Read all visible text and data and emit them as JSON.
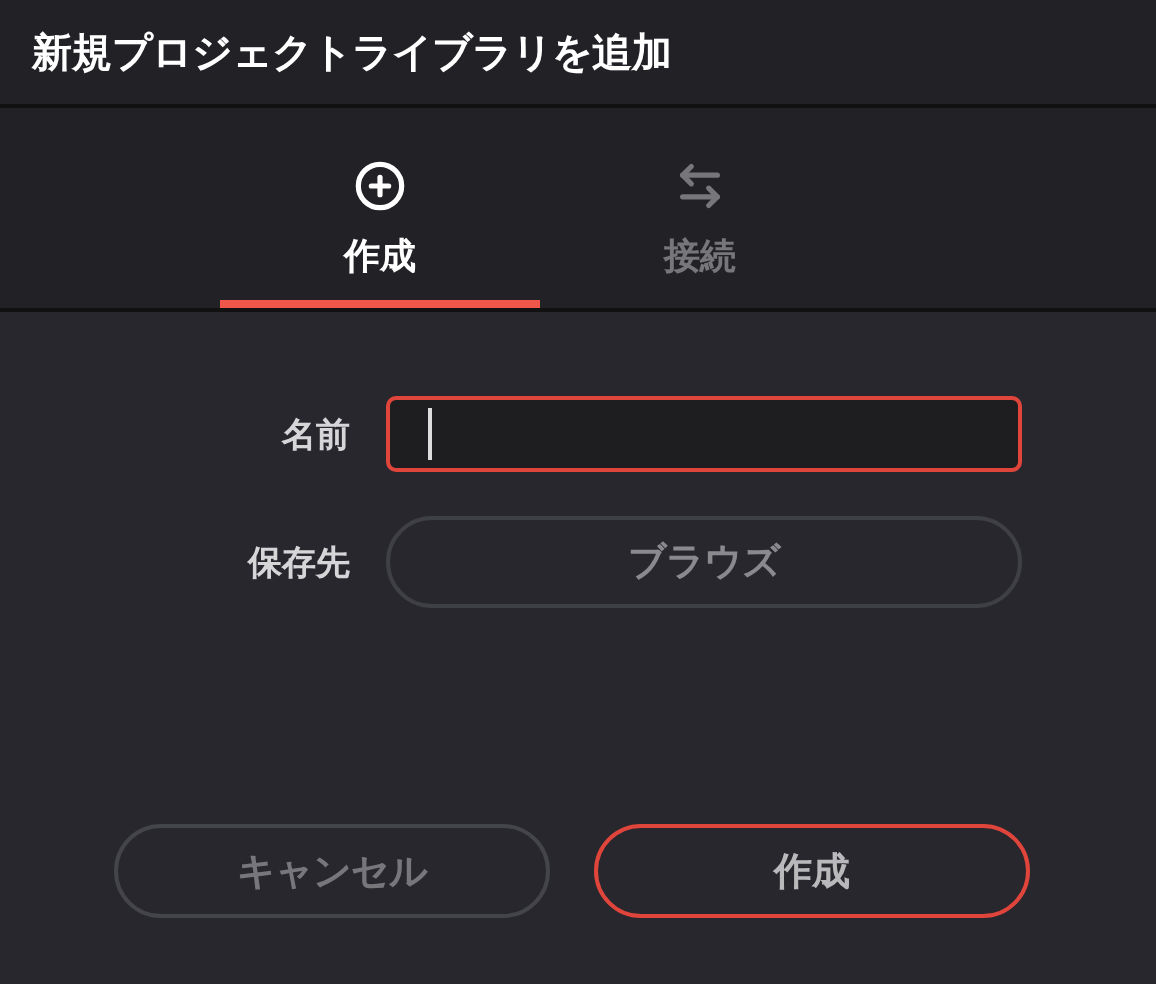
{
  "window": {
    "title": "新規プロジェクトライブラリを追加"
  },
  "tabs": [
    {
      "label": "作成",
      "selected": true
    },
    {
      "label": "接続",
      "selected": false
    }
  ],
  "form": {
    "name": {
      "label": "名前",
      "focused": true
    },
    "location": {
      "label": "保存先",
      "button": "ブラウズ"
    }
  },
  "buttons": [
    {
      "label": "キャンセル",
      "kind": "secondary"
    },
    {
      "label": "作成",
      "kind": "primary"
    }
  ]
}
